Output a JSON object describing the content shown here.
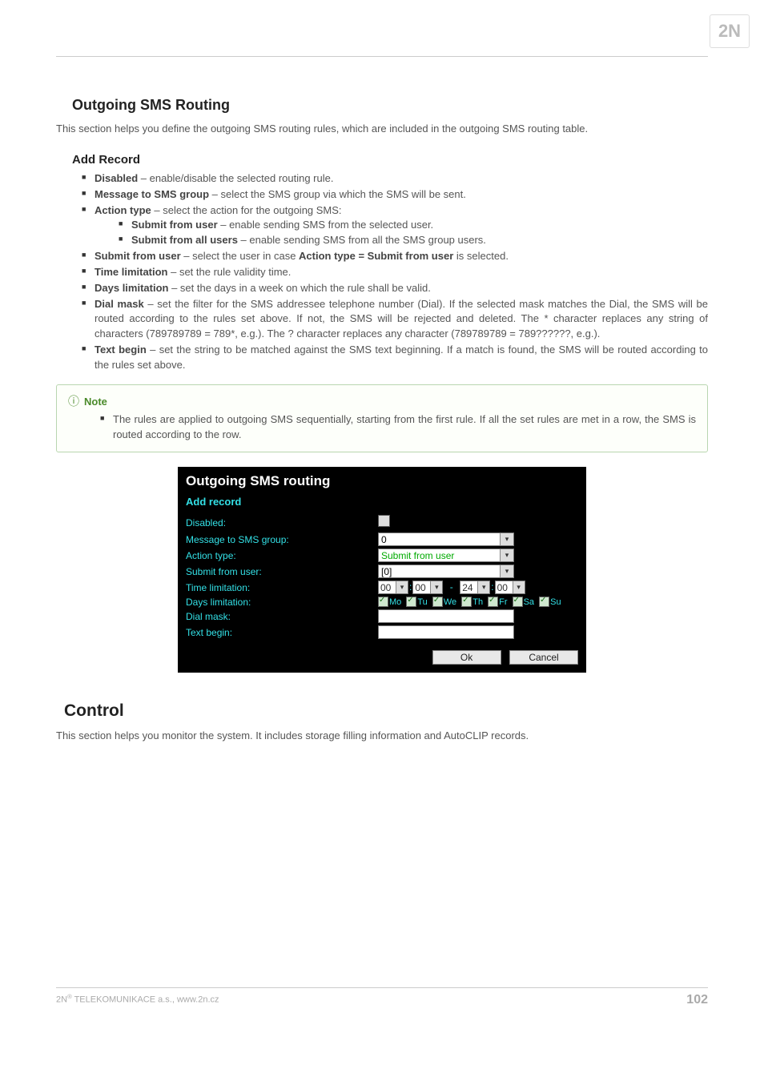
{
  "logo_text": "2N",
  "section_outgoing": {
    "heading": "Outgoing SMS Routing",
    "intro": "This section helps you define the outgoing SMS routing rules, which are included in the outgoing SMS routing table."
  },
  "add_record": {
    "heading": "Add Record",
    "items": [
      {
        "name": "Disabled",
        "desc": " – enable/disable the selected routing rule."
      },
      {
        "name": "Message to SMS group",
        "desc": " – select the SMS group via which the SMS will be sent."
      },
      {
        "name": "Action type",
        "desc": " – select the action for the outgoing SMS:",
        "sub": [
          {
            "name": "Submit from user",
            "desc": " – enable sending SMS from the selected user."
          },
          {
            "name": "Submit from all users",
            "desc": " – enable sending SMS from all the SMS group users."
          }
        ]
      },
      {
        "name": "Submit from user",
        "desc_pre": " – select the user in case ",
        "desc_bold": "Action type = Submit from user",
        "desc_post": " is selected."
      },
      {
        "name": "Time limitation",
        "desc": " – set the rule validity time."
      },
      {
        "name": "Days limitation",
        "desc": " – set the days in a week on which the rule shall be valid."
      },
      {
        "name": "Dial mask",
        "desc": " – set the filter for the SMS addressee telephone number (Dial). If the selected mask matches the Dial, the SMS will be routed according to the rules set above. If not, the SMS will be rejected and deleted. The * character replaces any string of characters (789789789 = 789*, e.g.). The ? character replaces any character (789789789 = 789??????, e.g.)."
      },
      {
        "name": "Text begin",
        "desc": " – set the string to be matched against the SMS text beginning. If a match is found, the SMS will be routed according to the rules set above."
      }
    ]
  },
  "note": {
    "title": "Note",
    "text": "The rules are applied to outgoing SMS sequentially, starting from the first rule. If all the set rules are met in a row, the SMS is routed according to the row."
  },
  "screenshot": {
    "title": "Outgoing SMS routing",
    "subtitle": "Add record",
    "labels": {
      "disabled": "Disabled:",
      "msg_group": "Message to SMS group:",
      "action_type": "Action type:",
      "submit_user": "Submit from user:",
      "time_limit": "Time limitation:",
      "days_limit": "Days limitation:",
      "dial_mask": "Dial mask:",
      "text_begin": "Text begin:"
    },
    "values": {
      "msg_group": "0",
      "action_type": "Submit from user",
      "submit_user": "[0]",
      "time_from_h": "00",
      "time_from_m": "00",
      "time_to_h": "24",
      "time_to_m": "00"
    },
    "days": [
      "Mo",
      "Tu",
      "We",
      "Th",
      "Fr",
      "Sa",
      "Su"
    ],
    "buttons": {
      "ok": "Ok",
      "cancel": "Cancel"
    }
  },
  "control": {
    "heading": "Control",
    "intro": "This section helps you monitor the system. It includes storage filling information and AutoCLIP records."
  },
  "footer": {
    "left_pre": "2N",
    "left_sup": "®",
    "left_post": " TELEKOMUNIKACE a.s., www.2n.cz",
    "page": "102"
  }
}
